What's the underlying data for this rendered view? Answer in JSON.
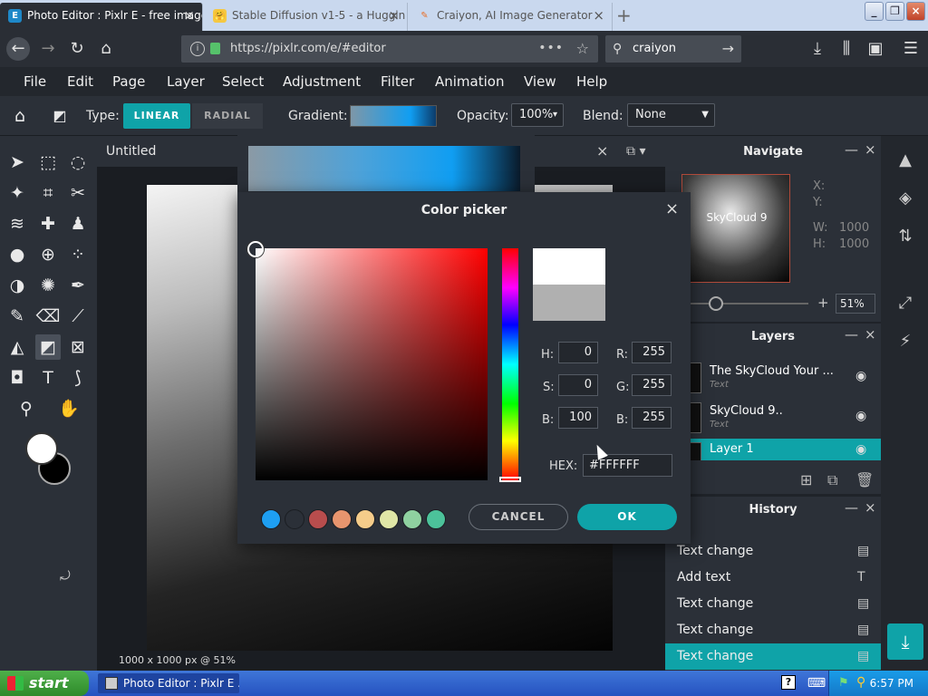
{
  "browser": {
    "tabs": [
      {
        "title": "Photo Editor : Pixlr E - free image",
        "icon": "E"
      },
      {
        "title": "Stable Diffusion v1-5 - a Huggin",
        "icon": "🤗"
      },
      {
        "title": "Craiyon, AI Image Generator",
        "icon": "✎"
      }
    ],
    "url": "https://pixlr.com/e/#editor",
    "search": "craiyon"
  },
  "menu": [
    "File",
    "Edit",
    "Page",
    "Layer",
    "Select",
    "Adjustment",
    "Filter",
    "Animation",
    "View",
    "Help"
  ],
  "options": {
    "type_label": "Type:",
    "linear": "LINEAR",
    "radial": "RADIAL",
    "gradient_label": "Gradient:",
    "opacity_label": "Opacity:",
    "opacity_value": "100%",
    "blend_label": "Blend:",
    "blend_value": "None"
  },
  "document": {
    "name": "Untitled",
    "info": "1000 x 1000 px @ 51%"
  },
  "navigate": {
    "title": "Navigate",
    "thumb_text": "SkyCloud 9",
    "x_label": "X:",
    "y_label": "Y:",
    "w_label": "W:",
    "w_value": "1000",
    "h_label": "H:",
    "h_value": "1000",
    "zoom": "51%"
  },
  "layers": {
    "title": "Layers",
    "items": [
      {
        "name": "The SkyCloud Your ...",
        "sub": "Text"
      },
      {
        "name": "SkyCloud 9..",
        "sub": "Text"
      },
      {
        "name": "Layer 1",
        "sub": ""
      }
    ]
  },
  "history": {
    "title": "History",
    "items": [
      "Text change",
      "Add text",
      "Text change",
      "Text change",
      "Text change"
    ]
  },
  "color_picker": {
    "title": "Color picker",
    "h_label": "H:",
    "h": "0",
    "s_label": "S:",
    "s": "0",
    "b_label": "B:",
    "b": "100",
    "r_label": "R:",
    "r": "255",
    "g_label": "G:",
    "g": "255",
    "bl_label": "B:",
    "bl": "255",
    "hex_label": "HEX:",
    "hex": "#FFFFFF",
    "cancel": "CANCEL",
    "ok": "OK",
    "swatches": [
      "#1e9ff2",
      "#2b3038",
      "#b84d4d",
      "#e8956e",
      "#f5cc8a",
      "#dfe6a6",
      "#8fd1a0",
      "#4cc29a"
    ]
  },
  "taskbar": {
    "start": "start",
    "task": "Photo Editor : Pixlr E ...",
    "time": "6:57 PM"
  }
}
